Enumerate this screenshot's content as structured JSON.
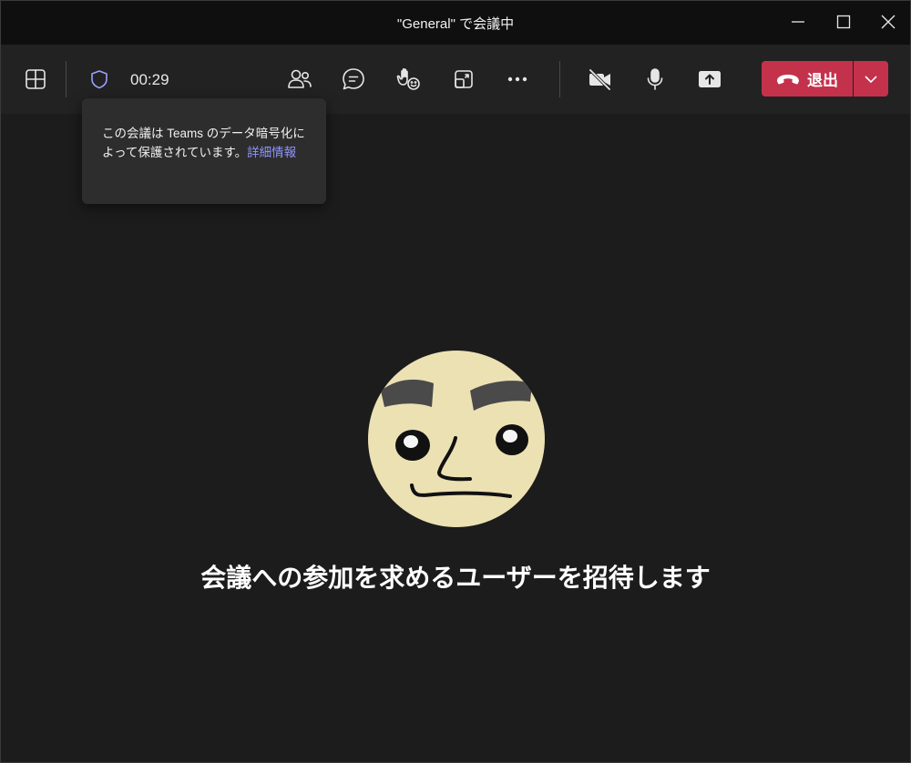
{
  "window": {
    "title": "\"General\" で会議中"
  },
  "toolbar": {
    "timer": "00:29",
    "leave_label": "退出",
    "icons": [
      "layout-grid-icon",
      "shield-icon",
      "people-icon",
      "chat-icon",
      "raise-hand-icon",
      "breakout-icon",
      "more-icon",
      "camera-off-icon",
      "mic-icon",
      "share-screen-icon",
      "phone-hangup-icon",
      "chevron-down-icon"
    ]
  },
  "tooltip": {
    "text": "この会議は Teams のデータ暗号化によって保護されています。",
    "link": "詳細情報"
  },
  "stage": {
    "invite_text": "会議への参加を求めるユーザーを招待します"
  },
  "colors": {
    "accent_purple": "#8f95ff",
    "leave_red": "#c4314b",
    "background": "#1c1c1c",
    "avatar_bg": "#ece1b3"
  }
}
